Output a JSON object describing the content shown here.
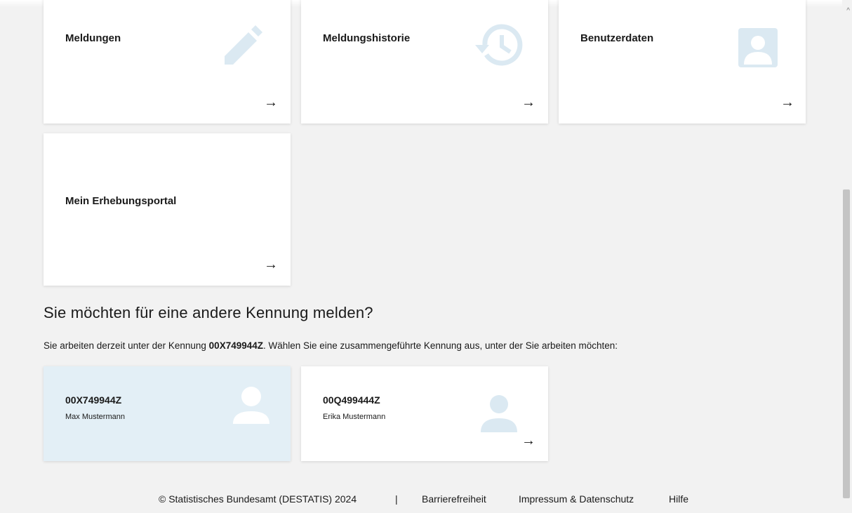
{
  "tiles": [
    {
      "title": "Meldungen",
      "icon": "pencil-icon",
      "arrow": "→"
    },
    {
      "title": "Meldungshistorie",
      "icon": "history-icon",
      "arrow": "→"
    },
    {
      "title": "Benutzerdaten",
      "icon": "user-card-icon",
      "arrow": "→"
    },
    {
      "title": "Mein Erhebungsportal",
      "arrow": "→"
    }
  ],
  "switch_section": {
    "heading": "Sie möchten für eine andere Kennung melden?",
    "intro_before": "Sie arbeiten derzeit unter der Kennung ",
    "current_id": "00X749944Z",
    "intro_after": ". Wählen Sie eine zusammengeführte Kennung aus, unter der Sie arbeiten möchten:",
    "accounts": [
      {
        "id": "00X749944Z",
        "name": "Max Mustermann",
        "selected": true
      },
      {
        "id": "00Q499444Z",
        "name": "Erika Mustermann",
        "selected": false,
        "arrow": "→"
      }
    ]
  },
  "footer": {
    "copyright": "© Statistisches Bundesamt (DESTATIS) 2024",
    "separator": "|",
    "links": [
      "Barrierefreiheit",
      "Impressum & Datenschutz",
      "Hilfe"
    ]
  },
  "colors": {
    "background": "#f2f2f2",
    "card": "#ffffff",
    "selected_card": "#e3eff6",
    "icon_tint": "#dbe9f2"
  }
}
